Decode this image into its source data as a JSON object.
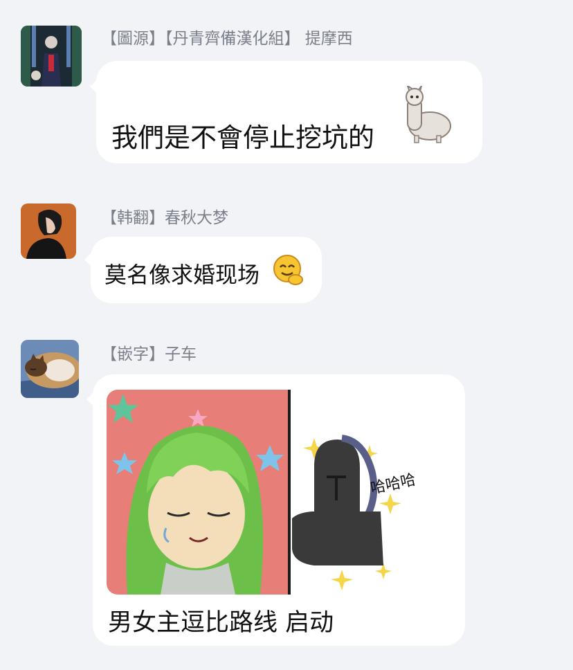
{
  "messages": [
    {
      "sender": "【圖源】【丹青齊備漢化組】 提摩西",
      "text": "我們是不會停止挖坑的",
      "sticker": "alpaca-sticker"
    },
    {
      "sender": "【韩翻】春秋大梦",
      "text": "莫名像求婚现场",
      "sticker": "giggle-emoji"
    },
    {
      "sender": "【嵌字】子车",
      "image_caption": "哈哈哈",
      "text": "男女主逗比路线 启动"
    }
  ],
  "colors": {
    "background": "#f2f3f6",
    "bubble": "#ffffff",
    "sender_text": "#7b7f89",
    "message_text": "#111111"
  }
}
